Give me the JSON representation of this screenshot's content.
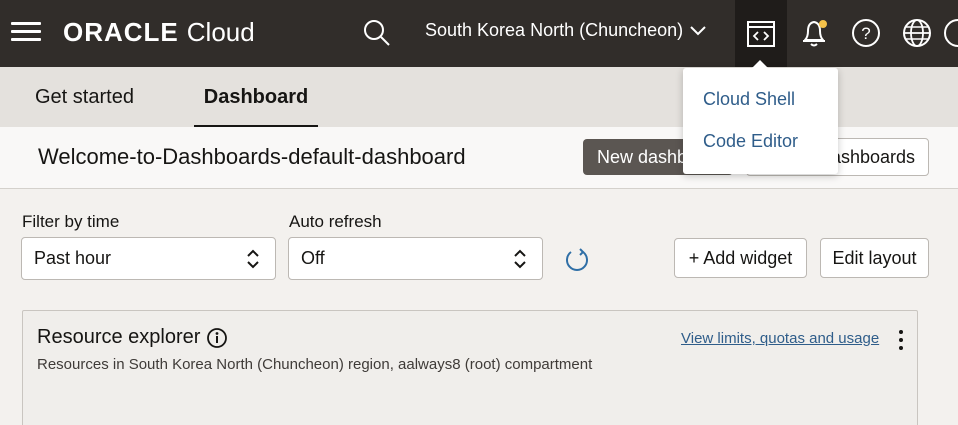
{
  "header": {
    "brand": "ORACLE",
    "product": "Cloud",
    "region": "South Korea North (Chuncheon)",
    "icons": {
      "menu": "hamburger-menu-icon",
      "search": "search-icon",
      "region_dropdown": "chevron-down-icon",
      "developer_tools": "code-window-icon",
      "notifications": "bell-icon",
      "help": "help-icon",
      "language": "globe-icon",
      "profile": "profile-icon"
    },
    "notification_dot_color": "#f6c34a"
  },
  "tabs": [
    {
      "label": "Get started",
      "active": false
    },
    {
      "label": "Dashboard",
      "active": true
    }
  ],
  "dashboard": {
    "title": "Welcome-to-Dashboards-default-dashboard",
    "new_dashboard_label": "New dashb",
    "dashboards_label": "ashboards"
  },
  "filters": {
    "time_label": "Filter by time",
    "time_value": "Past hour",
    "refresh_label": "Auto refresh",
    "refresh_value": "Off",
    "add_widget_label": "+ Add widget",
    "edit_layout_label": "Edit layout"
  },
  "widget": {
    "title": "Resource explorer",
    "subtitle": "Resources in South Korea North (Chuncheon) region, aalways8 (root) compartment",
    "link": "View limits, quotas and usage"
  },
  "dev_tools_menu": {
    "items": [
      "Cloud Shell",
      "Code Editor"
    ]
  },
  "colors": {
    "header_bg": "#312d2a",
    "link": "#2f5d8a",
    "primary_button": "#5b5652"
  }
}
